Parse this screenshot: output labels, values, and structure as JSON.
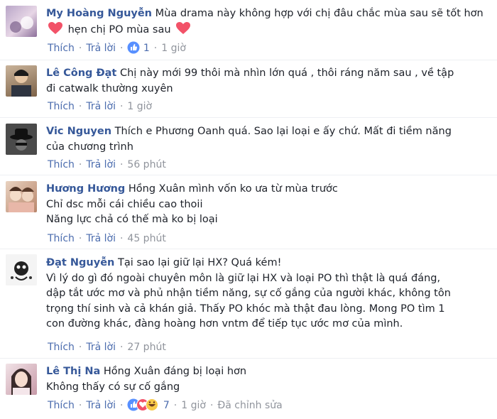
{
  "ui": {
    "like": "Thích",
    "reply": "Trả lời",
    "separator": "·"
  },
  "comments": [
    {
      "name": "My Hoàng Nguyễn",
      "text": "Mùa drama này không hợp với chị đâu chắc mùa sau sẽ tốt hơn",
      "text2": "hẹn chị PO mùa sau",
      "reaction_count": "1",
      "time": "1 giờ"
    },
    {
      "name": "Lê Công Đạt",
      "text": "Chị này mới 99 thôi mà nhìn lớn quá , thôi ráng năm sau , về tập",
      "text_line2": "đi catwalk thường xuyên",
      "time": "1 giờ"
    },
    {
      "name": "Vic Nguyen",
      "text": "Thích e Phương Oanh quá. Sao lại loại e ấy chứ. Mất đi tiềm năng",
      "text_line2": "của chương trình",
      "time": "56 phút"
    },
    {
      "name": "Hương Hương",
      "text": "Hồng Xuân mình vốn ko ưa từ mùa trước",
      "text_line2": "Chỉ dsc mỗi cái chiều cao thoii",
      "text_line3": "Năng lực chả có thế mà ko bị loại",
      "time": "45 phút"
    },
    {
      "name": "Đạt Nguyễn",
      "text": "Tại sao lại giữ lại HX? Quá kém!",
      "lines": [
        "Vì lý do gì đó ngoài chuyên môn là giữ lại HX và loại PO thì thật là quá đáng,",
        "dập tắt ước mơ và phủ nhận tiềm năng, sự cố gắng của người khác, không tôn",
        "trọng thí sinh và cả khán giả. Thấy PO khóc mà thật đau lòng. Mong PO tìm 1",
        "con đường khác, đàng hoàng hơn vntm để tiếp tục ước mơ của mình."
      ],
      "time": "27 phút"
    },
    {
      "name": "Lê Thị Na",
      "text": "Hồng Xuân đáng bị loại hơn",
      "text_line2": "Không thấy có sự cố gắng",
      "reaction_count": "7",
      "time": "1 giờ",
      "edited": "Đã chỉnh sửa"
    }
  ],
  "colors": {
    "name": "#365899",
    "link": "#4b6cae",
    "meta": "#90949c",
    "heart": "#f25268",
    "like_blue": "#5890ff"
  }
}
